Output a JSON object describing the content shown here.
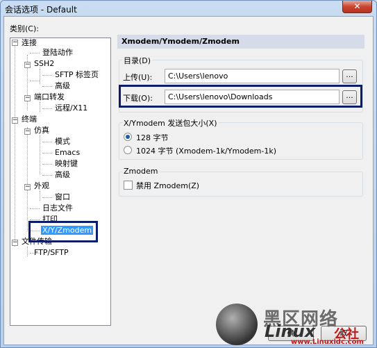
{
  "window": {
    "title": "会话选项 - Default",
    "close_glyph": "✕"
  },
  "category_label": "类别(C):",
  "tree": {
    "connection": "连接",
    "login_actions": "登陆动作",
    "ssh2": "SSH2",
    "sftp_tab": "SFTP 标签页",
    "advanced1": "高级",
    "port_forwarding": "端口转发",
    "remote_x11": "远程/X11",
    "terminal": "终端",
    "emulation": "仿真",
    "modes": "模式",
    "emacs": "Emacs",
    "key_mapping": "映射键",
    "advanced2": "高级",
    "appearance": "外观",
    "window": "窗口",
    "log_file": "日志文件",
    "printing": "打印",
    "xyzmodem": "X/Y/Zmodem",
    "file_transfer": "文件传输",
    "ftp_sftp": "FTP/SFTP"
  },
  "panel": {
    "header": "Xmodem/Ymodem/Zmodem",
    "dirs_group": "目录(D)",
    "upload_label": "上传(U):",
    "upload_value": "C:\\Users\\lenovo",
    "download_label": "下载(O):",
    "download_value": "C:\\Users\\lenovo\\Downloads",
    "browse_glyph": "...",
    "packet_group": "X/Ymodem 发送包大小(X)",
    "option_128": "128 字节",
    "option_1024": "1024 字节  (Xmodem-1k/Ymodem-1k)",
    "zmodem_group": "Zmodem",
    "disable_zmodem": "禁用 Zmodem(Z)"
  },
  "buttons": {
    "ok_partial": "确",
    "cancel_partial": "取"
  },
  "watermark": {
    "line1": "黑区网络",
    "line2": "Linux",
    "line3": "公社",
    "url": "www.Linuxidc.com"
  }
}
